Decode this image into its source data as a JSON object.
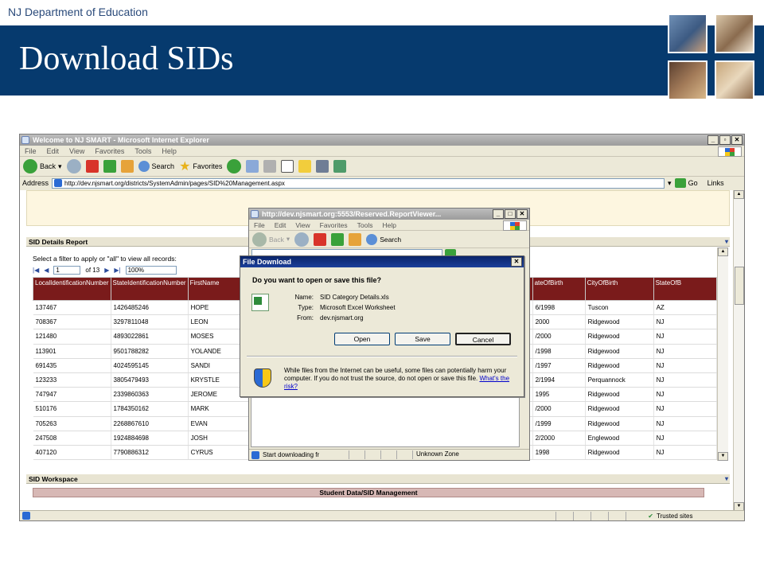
{
  "slide": {
    "org": "NJ Department of Education",
    "title": "Download SIDs"
  },
  "colors": {
    "banner": "#063a6e",
    "header_row": "#7a1b1b"
  },
  "browser": {
    "title": "Welcome to NJ SMART - Microsoft Internet Explorer",
    "menu": [
      "File",
      "Edit",
      "View",
      "Favorites",
      "Tools",
      "Help"
    ],
    "toolbar": {
      "back": "Back",
      "search": "Search",
      "favorites": "Favorites"
    },
    "address_label": "Address",
    "address": "http://dev.njsmart.org/districts/SystemAdmin/pages/SID%20Management.aspx",
    "go": "Go",
    "links": "Links",
    "status": {
      "zone": "Trusted sites"
    }
  },
  "report": {
    "section_title": "SID Details Report",
    "filter_hint": "Select a filter to apply or \"all\" to view all records:",
    "pager": {
      "page": "1",
      "of": "of 13",
      "zoom": "100%"
    },
    "columns": [
      "LocalIdentificationNumber",
      "StateIdentificationNumber",
      "FirstName",
      "ateOfBirth",
      "CityOfBirth",
      "StateOfB"
    ],
    "rows": [
      [
        "137467",
        "1426485246",
        "HOPE",
        "6/1998",
        "Tuscon",
        "AZ"
      ],
      [
        "708367",
        "3297811048",
        "LEON",
        "2000",
        "Ridgewood",
        "NJ"
      ],
      [
        "121480",
        "4893022861",
        "MOSES",
        "/2000",
        "Ridgewood",
        "NJ"
      ],
      [
        "113901",
        "9501788282",
        "YOLANDE",
        "/1998",
        "Ridgewood",
        "NJ"
      ],
      [
        "691435",
        "4024595145",
        "SANDI",
        "/1997",
        "Ridgewood",
        "NJ"
      ],
      [
        "123233",
        "3805479493",
        "KRYSTLE",
        "2/1994",
        "Perquannock",
        "NJ"
      ],
      [
        "747947",
        "2339860363",
        "JEROME",
        "1995",
        "Ridgewood",
        "NJ"
      ],
      [
        "510176",
        "1784350162",
        "MARK",
        "/2000",
        "Ridgewood",
        "NJ"
      ],
      [
        "705263",
        "2268867610",
        "EVAN",
        "/1999",
        "Ridgewood",
        "NJ"
      ],
      [
        "247508",
        "1924884698",
        "JOSH",
        "2/2000",
        "Englewood",
        "NJ"
      ],
      [
        "407120",
        "7790886312",
        "CYRUS",
        "1998",
        "Ridgewood",
        "NJ"
      ]
    ]
  },
  "workspace": {
    "section_title": "SID Workspace",
    "task_banner": "Student Data/SID Management"
  },
  "popup": {
    "title": "http://dev.njsmart.org:5553/Reserved.ReportViewer...",
    "menu": [
      "File",
      "Edit",
      "View",
      "Favorites",
      "Tools",
      "Help"
    ],
    "toolbar": {
      "back": "Back",
      "search": "Search"
    },
    "status_text": "Start downloading fr",
    "zone": "Unknown Zone"
  },
  "dialog": {
    "title": "File Download",
    "question": "Do you want to open or save this file?",
    "name_label": "Name:",
    "name_value": "SID Category Details.xls",
    "type_label": "Type:",
    "type_value": "Microsoft Excel Worksheet",
    "from_label": "From:",
    "from_value": "dev.njsmart.org",
    "open": "Open",
    "save": "Save",
    "cancel": "Cancel",
    "warning": "While files from the Internet can be useful, some files can potentially harm your computer. If you do not trust the source, do not open or save this file.",
    "risk_link": "What's the risk?"
  }
}
